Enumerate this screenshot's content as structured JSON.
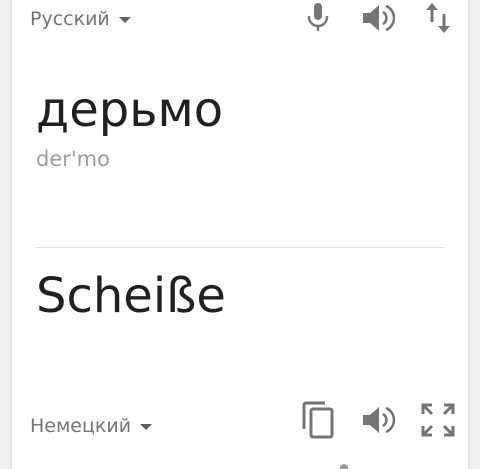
{
  "source_panel": {
    "language_label": "Русский",
    "text": "дерьмо",
    "transliteration": "der'mo",
    "icons": {
      "mic": "microphone-icon",
      "speaker": "speaker-icon",
      "swap": "swap-languages-icon"
    }
  },
  "target_panel": {
    "language_label": "Немецкий",
    "text": "Scheiße",
    "icons": {
      "copy": "copy-icon",
      "speaker": "speaker-icon",
      "fullscreen": "fullscreen-icon"
    }
  },
  "colors": {
    "icon": "#757575",
    "text": "#212121",
    "secondary_text": "#9e9e9e",
    "divider": "#e0e0e0",
    "card": "#ffffff"
  }
}
